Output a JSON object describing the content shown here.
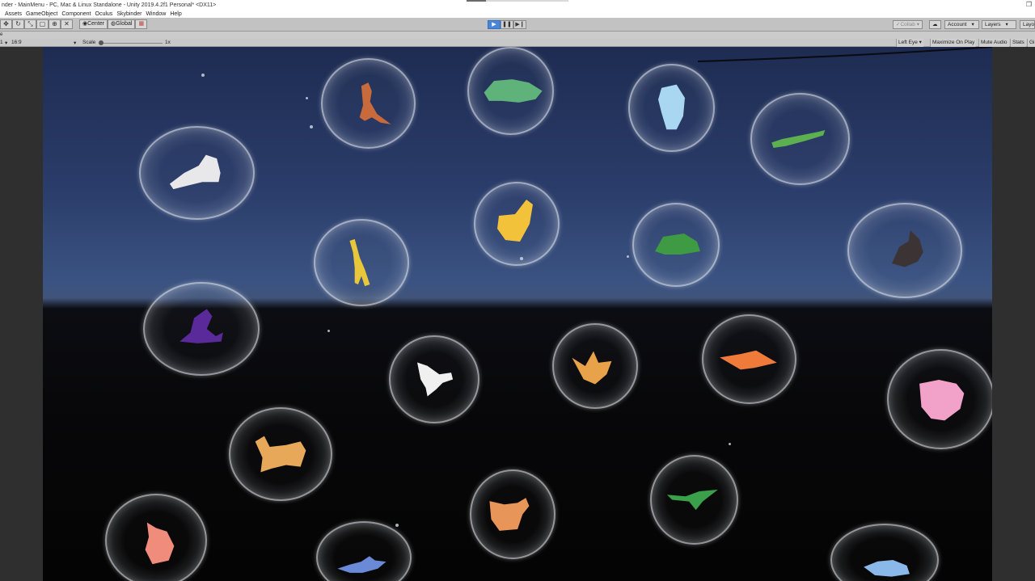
{
  "window": {
    "title": "nder - MainMenu - PC, Mac & Linux Standalone - Unity 2019.4.2f1 Personal* <DX11>"
  },
  "menu": [
    "Assets",
    "GameObject",
    "Component",
    "Oculus",
    "Skybinder",
    "Window",
    "Help"
  ],
  "toolbar": {
    "center_label": "Center",
    "global_label": "Global",
    "collab_label": "Collab",
    "account_label": "Account",
    "layers_label": "Layers",
    "layout_label": "Layo"
  },
  "game_view": {
    "tab_label": "e",
    "display_label": "1",
    "aspect_label": "16:9",
    "scale_label": "Scale",
    "scale_value": "1x",
    "eye_label": "Left Eye",
    "maximize_label": "Maximize On Play",
    "mute_label": "Mute Audio",
    "stats_label": "Stats",
    "gizmos_label": "Gi"
  },
  "scene": {
    "bubbles": [
      {
        "animal": "kangaroo",
        "color": "#c86a3c"
      },
      {
        "animal": "turtle",
        "color": "#5fb27a"
      },
      {
        "animal": "penguin",
        "color": "#a9d6f0"
      },
      {
        "animal": "crocodile",
        "color": "#5cb04f"
      },
      {
        "animal": "lion",
        "color": "#e8e8ea"
      },
      {
        "animal": "chick",
        "color": "#f2c23a"
      },
      {
        "animal": "frog",
        "color": "#3e9a43"
      },
      {
        "animal": "squirrel",
        "color": "#3c3434"
      },
      {
        "animal": "giraffe",
        "color": "#e8c83a"
      },
      {
        "animal": "witch-hat",
        "color": "#5b2a9a"
      },
      {
        "animal": "insect",
        "color": "#f0f0f0"
      },
      {
        "animal": "fox",
        "color": "#e8a24a"
      },
      {
        "animal": "ray",
        "color": "#f07a3a"
      },
      {
        "animal": "pig",
        "color": "#f2a2c8"
      },
      {
        "animal": "dog",
        "color": "#e8a85a"
      },
      {
        "animal": "duck",
        "color": "#e8955a"
      },
      {
        "animal": "bird",
        "color": "#3aa04a"
      },
      {
        "animal": "bear",
        "color": "#f08c7c"
      },
      {
        "animal": "shark",
        "color": "#6a8ad8"
      },
      {
        "animal": "whale",
        "color": "#8ab8e8"
      }
    ]
  },
  "colors": {
    "sky_top": "#1e2c52",
    "horizon": "#40547a",
    "ground": "#070709",
    "play_active": "#4a86d8"
  }
}
